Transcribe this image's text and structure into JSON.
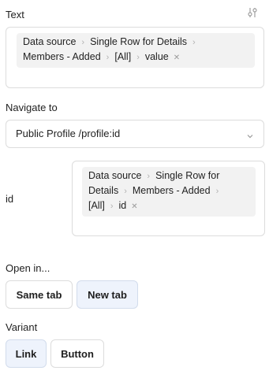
{
  "text_field": {
    "label": "Text",
    "icon": "sliders-icon",
    "tokens": [
      "Data source",
      "Single Row for Details",
      "Members - Added",
      "[All]",
      "value"
    ]
  },
  "navigate": {
    "label": "Navigate to",
    "selected": "Public Profile /profile:id",
    "icon": "chevron-down-icon"
  },
  "id_field": {
    "label": "id",
    "tokens": [
      "Data source",
      "Single Row for",
      "Details",
      "Members - Added",
      "[All]",
      "id"
    ]
  },
  "open_in": {
    "label": "Open in...",
    "options": [
      "Same tab",
      "New tab"
    ],
    "selected": "New tab"
  },
  "variant": {
    "label": "Variant",
    "options": [
      "Link",
      "Button"
    ],
    "selected": "Link"
  },
  "colors": {
    "selected_bg": "#eef3fc",
    "border": "#dcdcdc",
    "token_bg": "#f2f2f2"
  }
}
